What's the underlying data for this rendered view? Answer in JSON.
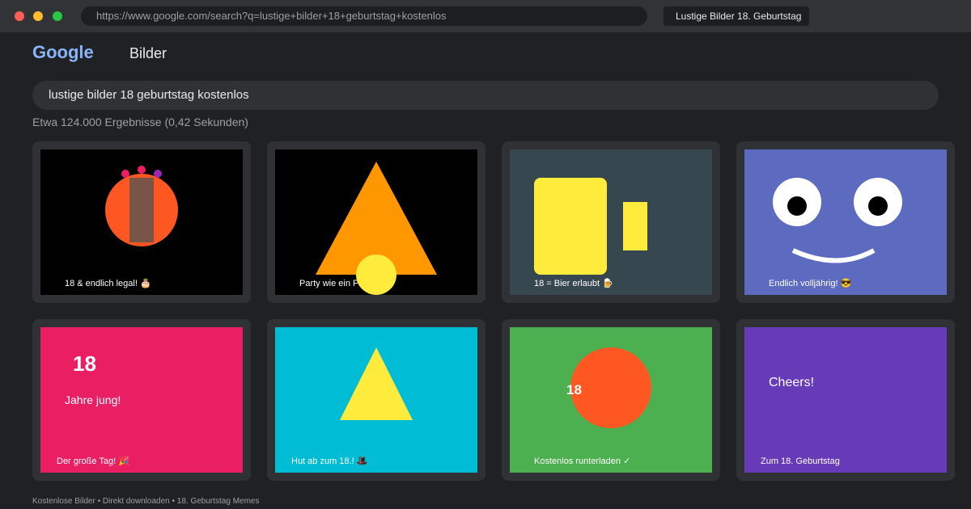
{
  "browser": {
    "url": "https://www.google.com/search?q=lustige+bilder+18+geburtstag+kostenlos",
    "tab_title": "Lustige Bilder 18. Geburtstag"
  },
  "header": {
    "logo": "Google",
    "vertical": "Bilder"
  },
  "search": {
    "query": "lustige bilder 18 geburtstag kostenlos",
    "stats": "Etwa 124.000 Ergebnisse (0,42 Sekunden)"
  },
  "results": [
    {
      "caption": "18 & endlich legal! 🎂",
      "bg": "#000000",
      "icon": "cake-icon"
    },
    {
      "caption": "Party wie ein Profi!",
      "bg": "#000000",
      "icon": "party-hat-icon"
    },
    {
      "caption": "18 = Bier erlaubt 🍺",
      "bg": "#37474f",
      "icon": "beer-icon"
    },
    {
      "caption": "Endlich volljährig! 😎",
      "bg": "#5c6bc0",
      "icon": "smiley-face-icon"
    },
    {
      "caption": "Der große Tag! 🎉",
      "bg": "#e91e63",
      "number": "18",
      "subtitle": "Jahre jung!"
    },
    {
      "caption": "Hut ab zum 18.! 🎩",
      "bg": "#00bcd4",
      "icon": "triangle-hat-icon"
    },
    {
      "caption": "Kostenlos runterladen ✓",
      "bg": "#4caf50",
      "number": "18",
      "icon": "balloon-icon"
    },
    {
      "caption": "Zum 18. Geburtstag",
      "bg": "#673ab7",
      "headline": "Cheers!"
    }
  ],
  "footer": {
    "text": "Kostenlose Bilder • Direkt downloaden • 18. Geburtstag Memes"
  }
}
